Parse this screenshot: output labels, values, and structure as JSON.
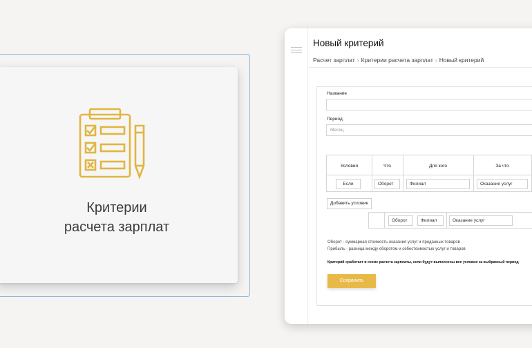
{
  "card": {
    "title_line1": "Критерии",
    "title_line2": "расчета зарплат",
    "icon": "clipboard-checklist-icon",
    "icon_color": "#e2b540"
  },
  "window": {
    "title": "Новый критерий",
    "breadcrumb": [
      "Расчет зарплат",
      "Критерии расчета зарплат",
      "Новый критерий"
    ]
  },
  "form": {
    "name_label": "Название",
    "name_value": "",
    "period_label": "Период",
    "period_placeholder": "Месяц",
    "table": {
      "headers": [
        "Условия",
        "Что",
        "Для кого",
        "За что"
      ],
      "row": [
        "Если",
        "Оборот",
        "Филиал",
        "Оказание услуг"
      ]
    },
    "add_condition_label": "Добавить условие",
    "extra_row": [
      "Оборот",
      "Филиал",
      "Оказание услуг"
    ],
    "note1": "Оборот - суммарная стоимость оказания услуг и проданных товаров",
    "note2": "Прибыль - разница между оборотом и себестоимостью услуг и товаров",
    "note_bold": "Критерий сработает в схеме расчета зарплаты, если будут выполнены все условия за выбранный период",
    "save_label": "Сохранить",
    "accent": "#e9b948"
  }
}
